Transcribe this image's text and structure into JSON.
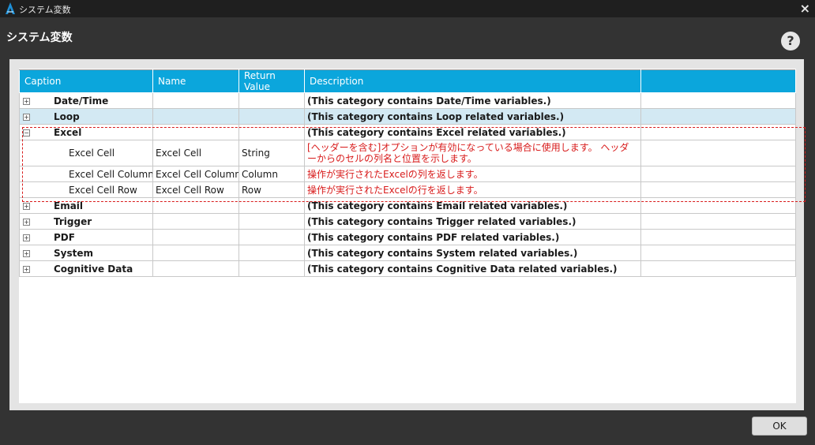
{
  "window": {
    "title": "システム変数",
    "close_glyph": "×"
  },
  "header": {
    "title": "システム変数",
    "help_glyph": "?"
  },
  "table": {
    "columns": [
      "Caption",
      "Name",
      "Return Value",
      "Description"
    ],
    "rows": [
      {
        "type": "category",
        "expander": "+",
        "caption": "Date/Time",
        "name": "",
        "ret": "",
        "desc": "(This category contains Date/Time variables.)"
      },
      {
        "type": "category",
        "expander": "+",
        "caption": "Loop",
        "name": "",
        "ret": "",
        "desc": "(This category contains Loop related variables.)",
        "selected": true
      },
      {
        "type": "category",
        "expander": "−",
        "caption": "Excel",
        "name": "",
        "ret": "",
        "desc": "(This category contains Excel related variables.)"
      },
      {
        "type": "item",
        "caption": "Excel Cell",
        "name": "Excel Cell",
        "ret": "String",
        "desc": "[ヘッダーを含む]オプションが有効になっている場合に使用します。 ヘッダーからのセルの列名と位置を示します。"
      },
      {
        "type": "item",
        "caption": "Excel Cell Column",
        "name": "Excel Cell Column",
        "ret": "Column",
        "desc": "操作が実行されたExcelの列を返します。"
      },
      {
        "type": "item",
        "caption": "Excel Cell Row",
        "name": "Excel Cell Row",
        "ret": "Row",
        "desc": "操作が実行されたExcelの行を返します。"
      },
      {
        "type": "category",
        "expander": "+",
        "caption": "Email",
        "name": "",
        "ret": "",
        "desc": "(This category contains Email related variables.)"
      },
      {
        "type": "category",
        "expander": "+",
        "caption": "Trigger",
        "name": "",
        "ret": "",
        "desc": "(This category contains Trigger related variables.)"
      },
      {
        "type": "category",
        "expander": "+",
        "caption": "PDF",
        "name": "",
        "ret": "",
        "desc": "(This category contains PDF related variables.)"
      },
      {
        "type": "category",
        "expander": "+",
        "caption": "System",
        "name": "",
        "ret": "",
        "desc": "(This category contains System related variables.)"
      },
      {
        "type": "category",
        "expander": "+",
        "caption": "Cognitive Data",
        "name": "",
        "ret": "",
        "desc": "(This category contains Cognitive Data related variables.)"
      }
    ]
  },
  "footer": {
    "ok_label": "OK"
  },
  "colors": {
    "header_accent": "#0ba6dc",
    "selected_row": "#d3e9f3",
    "highlight_red": "#d81b1b"
  }
}
